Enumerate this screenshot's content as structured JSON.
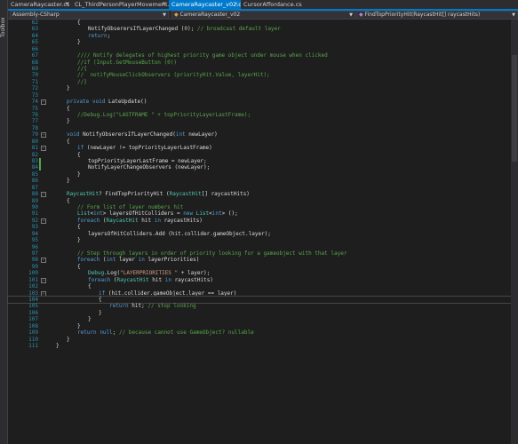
{
  "side_panel": {
    "label": "Toolbox"
  },
  "tabs": [
    {
      "label": "CameraRaycaster.cs",
      "active": false
    },
    {
      "label": "CL_ThirdPersonPlayerMovement.cs",
      "active": false
    },
    {
      "label": "CameraRaycaster_v02.cs",
      "active": true
    },
    {
      "label": "CursorAffordance.cs",
      "active": false
    }
  ],
  "navbar": {
    "project": "Assembly-CSharp",
    "class": "CameraRaycaster_v02",
    "member": "FindTopPriorityHit(RaycastHit[] raycastHits)"
  },
  "colors": {
    "keyword": "#569cd6",
    "type": "#4ec9b0",
    "comment": "#57a64a",
    "string": "#d69d85",
    "number": "#b5cea8",
    "line_number": "#2b91af",
    "tab_active": "#007acc"
  },
  "lines": [
    {
      "n": "62",
      "t": "{",
      "fold": false
    },
    {
      "n": "63",
      "t": "NotifyObserersIfLayerChanged (0); // broadcast default layer"
    },
    {
      "n": "64",
      "t": "return;"
    },
    {
      "n": "65",
      "t": "}"
    },
    {
      "n": "66",
      "t": ""
    },
    {
      "n": "67",
      "t": "//// Notify delegates of highest priority game object under mouse when clicked"
    },
    {
      "n": "68",
      "t": "//if (Input.GetMouseButton (0))"
    },
    {
      "n": "69",
      "t": "//{"
    },
    {
      "n": "70",
      "t": "//  notifyMouseClickObservers (priorityHit.Value, layerHit);"
    },
    {
      "n": "71",
      "t": "//}"
    },
    {
      "n": "72",
      "t": "}"
    },
    {
      "n": "73",
      "t": ""
    },
    {
      "n": "74",
      "t": "private void LateUpdate()"
    },
    {
      "n": "75",
      "t": "{"
    },
    {
      "n": "76",
      "t": "//Debug.Log(\"LASTFRAME \" + topPriorityLayerLastFrame);"
    },
    {
      "n": "77",
      "t": "}"
    },
    {
      "n": "78",
      "t": ""
    },
    {
      "n": "79",
      "t": "void NotifyObserersIfLayerChanged(int newLayer)"
    },
    {
      "n": "80",
      "t": "{"
    },
    {
      "n": "81",
      "t": "if (newLayer != topPriorityLayerLastFrame)"
    },
    {
      "n": "82",
      "t": "{"
    },
    {
      "n": "83",
      "t": "topPriorityLayerLastFrame = newLayer;"
    },
    {
      "n": "84",
      "t": "NotifyLayerChangeObservers (newLayer);"
    },
    {
      "n": "85",
      "t": "}"
    },
    {
      "n": "86",
      "t": "}"
    },
    {
      "n": "87",
      "t": ""
    },
    {
      "n": "88",
      "t": "RaycastHit? FindTopPriorityHit (RaycastHit[] raycastHits)"
    },
    {
      "n": "89",
      "t": "{"
    },
    {
      "n": "90",
      "t": "// Form list of layer numbers hit"
    },
    {
      "n": "91",
      "t": "List<int> layersOfHitColliders = new List<int> ();"
    },
    {
      "n": "92",
      "t": "foreach (RaycastHit hit in raycastHits)"
    },
    {
      "n": "93",
      "t": "{"
    },
    {
      "n": "94",
      "t": "layersOfHitColliders.Add (hit.collider.gameObject.layer);"
    },
    {
      "n": "95",
      "t": "}"
    },
    {
      "n": "96",
      "t": ""
    },
    {
      "n": "97",
      "t": "// Step through layers in order of priority looking for a gameobject with that layer"
    },
    {
      "n": "98",
      "t": "foreach (int layer in layerPriorities)"
    },
    {
      "n": "99",
      "t": "{"
    },
    {
      "n": "100",
      "t": "Debug.Log(\"LAYERPRIORITIES \" + layer);"
    },
    {
      "n": "101",
      "t": "foreach (RaycastHit hit in raycastHits)"
    },
    {
      "n": "102",
      "t": "{"
    },
    {
      "n": "103",
      "t": "if (hit.collider.gameObject.layer == layer)"
    },
    {
      "n": "104",
      "t": "{"
    },
    {
      "n": "105",
      "t": "return hit; // stop looking"
    },
    {
      "n": "106",
      "t": "}"
    },
    {
      "n": "107",
      "t": "}"
    },
    {
      "n": "108",
      "t": "}"
    },
    {
      "n": "109",
      "t": "return null; // because cannot use GameObject? nullable"
    },
    {
      "n": "110",
      "t": "}"
    },
    {
      "n": "111",
      "t": "}"
    }
  ]
}
